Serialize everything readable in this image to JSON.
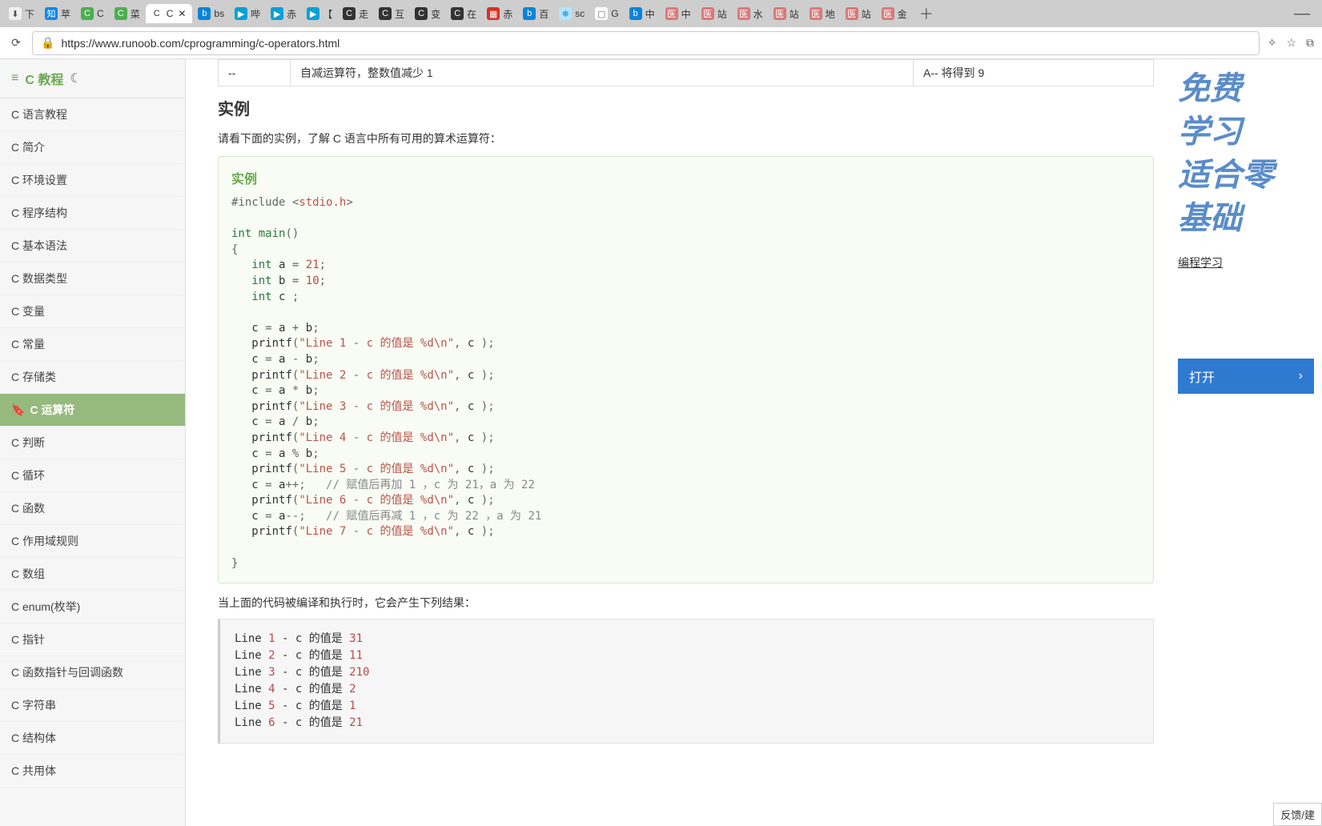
{
  "browser": {
    "tabs": [
      {
        "icon_bg": "#f0f0f0",
        "icon_fg": "#555",
        "icon": "⬇",
        "label": "下"
      },
      {
        "icon_bg": "#0f88eb",
        "icon_fg": "#fff",
        "icon": "知",
        "label": "苹"
      },
      {
        "icon_bg": "#4caf50",
        "icon_fg": "#fff",
        "icon": "C",
        "label": "C"
      },
      {
        "icon_bg": "#4caf50",
        "icon_fg": "#fff",
        "icon": "C",
        "label": "菜"
      },
      {
        "icon_bg": "#ffffff",
        "icon_fg": "#333",
        "icon": "C",
        "label": "C",
        "active": true,
        "closable": true
      },
      {
        "icon_bg": "#0a84d8",
        "icon_fg": "#fff",
        "icon": "b",
        "label": "bs"
      },
      {
        "icon_bg": "#00a1d6",
        "icon_fg": "#fff",
        "icon": "▶",
        "label": "哔"
      },
      {
        "icon_bg": "#00a1d6",
        "icon_fg": "#fff",
        "icon": "▶",
        "label": "赤"
      },
      {
        "icon_bg": "#00a1d6",
        "icon_fg": "#fff",
        "icon": "▶",
        "label": "【"
      },
      {
        "icon_bg": "#333333",
        "icon_fg": "#fff",
        "icon": "C",
        "label": "走"
      },
      {
        "icon_bg": "#333333",
        "icon_fg": "#fff",
        "icon": "C",
        "label": "互"
      },
      {
        "icon_bg": "#333333",
        "icon_fg": "#fff",
        "icon": "C",
        "label": "变"
      },
      {
        "icon_bg": "#333333",
        "icon_fg": "#fff",
        "icon": "C",
        "label": "在"
      },
      {
        "icon_bg": "#d93025",
        "icon_fg": "#fff",
        "icon": "▦",
        "label": "赤"
      },
      {
        "icon_bg": "#0a84d8",
        "icon_fg": "#fff",
        "icon": "b",
        "label": "百"
      },
      {
        "icon_bg": "#b3e5fc",
        "icon_fg": "#0288d1",
        "icon": "❄",
        "label": "sc"
      },
      {
        "icon_bg": "#ffffff",
        "icon_fg": "#666",
        "icon": "▢",
        "label": "G"
      },
      {
        "icon_bg": "#0a84d8",
        "icon_fg": "#fff",
        "icon": "b",
        "label": "中"
      },
      {
        "icon_bg": "#d77a7a",
        "icon_fg": "#fff",
        "icon": "医",
        "label": "中"
      },
      {
        "icon_bg": "#d77a7a",
        "icon_fg": "#fff",
        "icon": "医",
        "label": "站"
      },
      {
        "icon_bg": "#d77a7a",
        "icon_fg": "#fff",
        "icon": "医",
        "label": "水"
      },
      {
        "icon_bg": "#d77a7a",
        "icon_fg": "#fff",
        "icon": "医",
        "label": "站"
      },
      {
        "icon_bg": "#d77a7a",
        "icon_fg": "#fff",
        "icon": "医",
        "label": "地"
      },
      {
        "icon_bg": "#d77a7a",
        "icon_fg": "#fff",
        "icon": "医",
        "label": "站"
      },
      {
        "icon_bg": "#d77a7a",
        "icon_fg": "#fff",
        "icon": "医",
        "label": "金"
      }
    ],
    "url": "https://www.runoob.com/cprogramming/c-operators.html"
  },
  "sidebar": {
    "title": "C 教程",
    "items": [
      "C 语言教程",
      "C 简介",
      "C 环境设置",
      "C 程序结构",
      "C 基本语法",
      "C 数据类型",
      "C 变量",
      "C 常量",
      "C 存储类",
      "C 运算符",
      "C 判断",
      "C 循环",
      "C 函数",
      "C 作用域规则",
      "C 数组",
      "C enum(枚举)",
      "C 指针",
      "C 函数指针与回调函数",
      "C 字符串",
      "C 结构体",
      "C 共用体"
    ],
    "active_index": 9
  },
  "content": {
    "table_row": {
      "op": "--",
      "desc": "自减运算符，整数值减少 1",
      "ex": "A-- 将得到 9"
    },
    "h2": "实例",
    "intro": "请看下面的实例，了解 C 语言中所有可用的算术运算符：",
    "example_title": "实例",
    "out_intro": "当上面的代码被编译和执行时，它会产生下列结果：",
    "output_lines": [
      {
        "pre": "Line ",
        "n": "1",
        "mid": " - c 的值是 ",
        "v": "31"
      },
      {
        "pre": "Line ",
        "n": "2",
        "mid": " - c 的值是 ",
        "v": "11"
      },
      {
        "pre": "Line ",
        "n": "3",
        "mid": " - c 的值是 ",
        "v": "210"
      },
      {
        "pre": "Line ",
        "n": "4",
        "mid": " - c 的值是 ",
        "v": "2"
      },
      {
        "pre": "Line ",
        "n": "5",
        "mid": " - c 的值是 ",
        "v": "1"
      },
      {
        "pre": "Line ",
        "n": "6",
        "mid": " - c 的值是 ",
        "v": "21"
      }
    ],
    "code_tokens": [
      [
        {
          "c": "punc",
          "t": "#include"
        },
        {
          "t": " "
        },
        {
          "c": "punc",
          "t": "<"
        },
        {
          "c": "str",
          "t": "stdio.h"
        },
        {
          "c": "punc",
          "t": ">"
        }
      ],
      [],
      [
        {
          "c": "kw",
          "t": "int"
        },
        {
          "t": " "
        },
        {
          "c": "kw",
          "t": "main"
        },
        {
          "c": "punc",
          "t": "()"
        }
      ],
      [
        {
          "c": "punc",
          "t": "{"
        }
      ],
      [
        {
          "t": "   "
        },
        {
          "c": "kw",
          "t": "int"
        },
        {
          "t": " a "
        },
        {
          "c": "punc",
          "t": "="
        },
        {
          "t": " "
        },
        {
          "c": "num",
          "t": "21"
        },
        {
          "c": "punc",
          "t": ";"
        }
      ],
      [
        {
          "t": "   "
        },
        {
          "c": "kw",
          "t": "int"
        },
        {
          "t": " b "
        },
        {
          "c": "punc",
          "t": "="
        },
        {
          "t": " "
        },
        {
          "c": "num",
          "t": "10"
        },
        {
          "c": "punc",
          "t": ";"
        }
      ],
      [
        {
          "t": "   "
        },
        {
          "c": "kw",
          "t": "int"
        },
        {
          "t": " c "
        },
        {
          "c": "punc",
          "t": ";"
        }
      ],
      [],
      [
        {
          "t": "   c "
        },
        {
          "c": "punc",
          "t": "="
        },
        {
          "t": " a "
        },
        {
          "c": "punc",
          "t": "+"
        },
        {
          "t": " b"
        },
        {
          "c": "punc",
          "t": ";"
        }
      ],
      [
        {
          "t": "   "
        },
        {
          "c": "fn",
          "t": "printf"
        },
        {
          "c": "punc",
          "t": "("
        },
        {
          "c": "str",
          "t": "\"Line 1 - c 的值是 %d\\n\""
        },
        {
          "c": "punc",
          "t": ","
        },
        {
          "t": " c "
        },
        {
          "c": "punc",
          "t": ");"
        }
      ],
      [
        {
          "t": "   c "
        },
        {
          "c": "punc",
          "t": "="
        },
        {
          "t": " a "
        },
        {
          "c": "punc",
          "t": "-"
        },
        {
          "t": " b"
        },
        {
          "c": "punc",
          "t": ";"
        }
      ],
      [
        {
          "t": "   "
        },
        {
          "c": "fn",
          "t": "printf"
        },
        {
          "c": "punc",
          "t": "("
        },
        {
          "c": "str",
          "t": "\"Line 2 - c 的值是 %d\\n\""
        },
        {
          "c": "punc",
          "t": ","
        },
        {
          "t": " c "
        },
        {
          "c": "punc",
          "t": ");"
        }
      ],
      [
        {
          "t": "   c "
        },
        {
          "c": "punc",
          "t": "="
        },
        {
          "t": " a "
        },
        {
          "c": "punc",
          "t": "*"
        },
        {
          "t": " b"
        },
        {
          "c": "punc",
          "t": ";"
        }
      ],
      [
        {
          "t": "   "
        },
        {
          "c": "fn",
          "t": "printf"
        },
        {
          "c": "punc",
          "t": "("
        },
        {
          "c": "str",
          "t": "\"Line 3 - c 的值是 %d\\n\""
        },
        {
          "c": "punc",
          "t": ","
        },
        {
          "t": " c "
        },
        {
          "c": "punc",
          "t": ");"
        }
      ],
      [
        {
          "t": "   c "
        },
        {
          "c": "punc",
          "t": "="
        },
        {
          "t": " a "
        },
        {
          "c": "punc",
          "t": "/"
        },
        {
          "t": " b"
        },
        {
          "c": "punc",
          "t": ";"
        }
      ],
      [
        {
          "t": "   "
        },
        {
          "c": "fn",
          "t": "printf"
        },
        {
          "c": "punc",
          "t": "("
        },
        {
          "c": "str",
          "t": "\"Line 4 - c 的值是 %d\\n\""
        },
        {
          "c": "punc",
          "t": ","
        },
        {
          "t": " c "
        },
        {
          "c": "punc",
          "t": ");"
        }
      ],
      [
        {
          "t": "   c "
        },
        {
          "c": "punc",
          "t": "="
        },
        {
          "t": " a "
        },
        {
          "c": "punc",
          "t": "%"
        },
        {
          "t": " b"
        },
        {
          "c": "punc",
          "t": ";"
        }
      ],
      [
        {
          "t": "   "
        },
        {
          "c": "fn",
          "t": "printf"
        },
        {
          "c": "punc",
          "t": "("
        },
        {
          "c": "str",
          "t": "\"Line 5 - c 的值是 %d\\n\""
        },
        {
          "c": "punc",
          "t": ","
        },
        {
          "t": " c "
        },
        {
          "c": "punc",
          "t": ");"
        }
      ],
      [
        {
          "t": "   c "
        },
        {
          "c": "punc",
          "t": "="
        },
        {
          "t": " a"
        },
        {
          "c": "punc",
          "t": "++;"
        },
        {
          "t": "   "
        },
        {
          "c": "cmt",
          "t": "// 赋值后再加 1 ，c 为 21，a 为 22"
        }
      ],
      [
        {
          "t": "   "
        },
        {
          "c": "fn",
          "t": "printf"
        },
        {
          "c": "punc",
          "t": "("
        },
        {
          "c": "str",
          "t": "\"Line 6 - c 的值是 %d\\n\""
        },
        {
          "c": "punc",
          "t": ","
        },
        {
          "t": " c "
        },
        {
          "c": "punc",
          "t": ");"
        }
      ],
      [
        {
          "t": "   c "
        },
        {
          "c": "punc",
          "t": "="
        },
        {
          "t": " a"
        },
        {
          "c": "punc",
          "t": "--;"
        },
        {
          "t": "   "
        },
        {
          "c": "cmt",
          "t": "// 赋值后再减 1 ，c 为 22 ，a 为 21"
        }
      ],
      [
        {
          "t": "   "
        },
        {
          "c": "fn",
          "t": "printf"
        },
        {
          "c": "punc",
          "t": "("
        },
        {
          "c": "str",
          "t": "\"Line 7 - c 的值是 %d\\n\""
        },
        {
          "c": "punc",
          "t": ","
        },
        {
          "t": " c "
        },
        {
          "c": "punc",
          "t": ");"
        }
      ],
      [],
      [
        {
          "c": "punc",
          "t": "}"
        }
      ]
    ]
  },
  "aside": {
    "ad_lines": [
      "免费",
      "学习",
      "适合零",
      "基础"
    ],
    "link": "编程学习",
    "open_btn": "打开"
  },
  "feedback": "反馈/建"
}
